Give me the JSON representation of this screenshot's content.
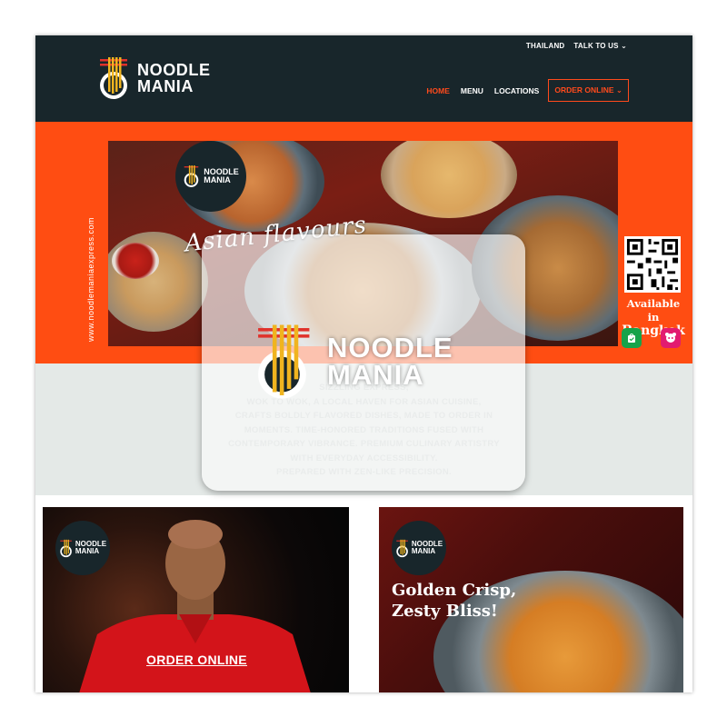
{
  "topnav": {
    "country": "THAILAND",
    "talk": "TALK TO US ⌄"
  },
  "brand": {
    "line1": "NOODLE",
    "line2": "MANIA"
  },
  "mainnav": {
    "home": "HOME",
    "menu": "MENU",
    "locations": "LOCATIONS",
    "order_online": "ORDER ONLINE ⌄"
  },
  "hero": {
    "side_url": "www.noodlemaniaexpress.com",
    "tagline": "Asian flavours",
    "available_line1": "Available in",
    "available_line2": "Bangkok"
  },
  "intro": {
    "lines": [
      "SIZZLING EXPRESS,",
      "WOK TO WOK, A LOCAL HAVEN FOR ASIAN CUISINE,",
      "CRAFTS BOLDLY FLAVORED DISHES, MADE TO ORDER IN",
      "MOMENTS. TIME-HONORED TRADITIONS FUSED WITH",
      "CONTEMPORARY VIBRANCE. PREMIUM CULINARY ARTISTRY",
      "WITH EVERYDAY ACCESSIBILITY.",
      "PREPARED WITH ZEN-LIKE PRECISION."
    ]
  },
  "cards": {
    "left_cta": "ORDER ONLINE",
    "right_line1": "Golden Crisp,",
    "right_line2": "Zesty Bliss!"
  },
  "colors": {
    "header_bg": "#18262b",
    "accent": "#ff4a1c",
    "hero_bg": "#ff4d12",
    "intro_bg": "#e4e9e7"
  }
}
